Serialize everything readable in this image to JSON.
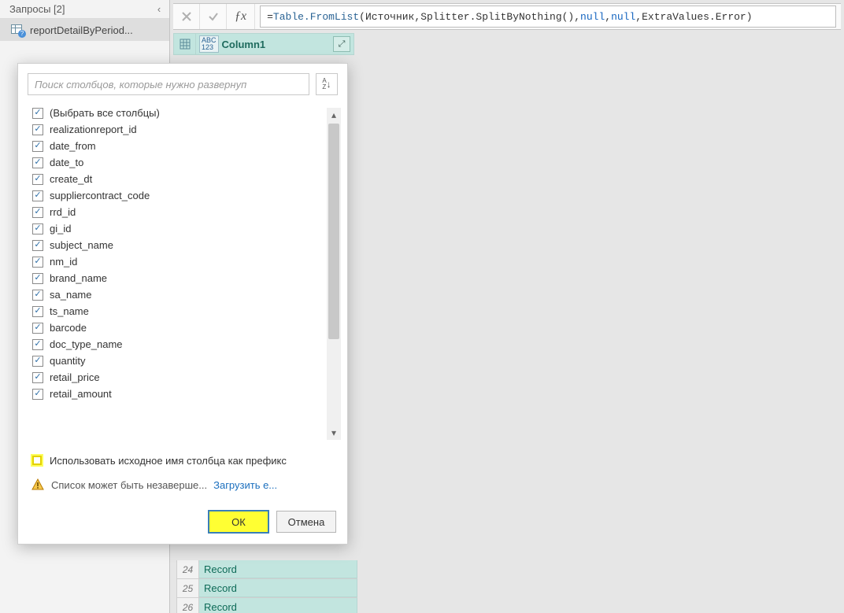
{
  "queries_panel": {
    "title": "Запросы [2]",
    "item_name": "reportDetailByPeriod..."
  },
  "formula_bar": {
    "prefix": "= ",
    "fn": "Table.FromList",
    "open": "(",
    "arg1": "Источник",
    "sep": ", ",
    "arg2": "Splitter.SplitByNothing()",
    "arg3": "null",
    "arg4": "null",
    "arg5": "ExtraValues.Error",
    "close": ")"
  },
  "grid": {
    "type_label": "ABC\n123",
    "col_name": "Column1",
    "rows": [
      {
        "n": "24",
        "v": "Record"
      },
      {
        "n": "25",
        "v": "Record"
      },
      {
        "n": "26",
        "v": "Record"
      }
    ]
  },
  "popup": {
    "search_placeholder": "Поиск столбцов, которые нужно развернуп",
    "sort_label": "A↓Z",
    "columns": [
      {
        "label": "(Выбрать все столбцы)",
        "checked": true
      },
      {
        "label": "realizationreport_id",
        "checked": true
      },
      {
        "label": "date_from",
        "checked": true
      },
      {
        "label": "date_to",
        "checked": true
      },
      {
        "label": "create_dt",
        "checked": true
      },
      {
        "label": "suppliercontract_code",
        "checked": true
      },
      {
        "label": "rrd_id",
        "checked": true
      },
      {
        "label": "gi_id",
        "checked": true
      },
      {
        "label": "subject_name",
        "checked": true
      },
      {
        "label": "nm_id",
        "checked": true
      },
      {
        "label": "brand_name",
        "checked": true
      },
      {
        "label": "sa_name",
        "checked": true
      },
      {
        "label": "ts_name",
        "checked": true
      },
      {
        "label": "barcode",
        "checked": true
      },
      {
        "label": "doc_type_name",
        "checked": true
      },
      {
        "label": "quantity",
        "checked": true
      },
      {
        "label": "retail_price",
        "checked": true
      },
      {
        "label": "retail_amount",
        "checked": true
      }
    ],
    "prefix_checkbox_label": "Использовать исходное имя столбца как префикс",
    "warning_text": "Список может быть незаверше...",
    "load_more_link": "Загрузить е...",
    "ok_label": "ОК",
    "cancel_label": "Отмена"
  }
}
